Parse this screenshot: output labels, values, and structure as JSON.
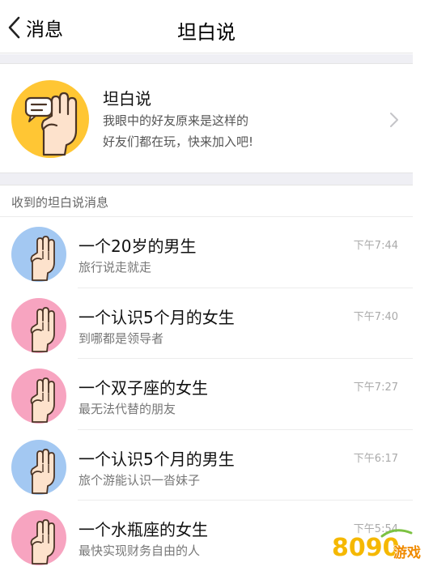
{
  "nav": {
    "back_label": "消息",
    "title": "坦白说"
  },
  "banner": {
    "title": "坦白说",
    "desc_line1": "我眼中的好友原来是这样的",
    "desc_line2": "好友们都在玩，快来加入吧!"
  },
  "section": {
    "header": "收到的坦白说消息"
  },
  "messages": [
    {
      "title": "一个20岁的男生",
      "subtitle": "旅行说走就走",
      "time": "下午7:44",
      "avatar_color": "#a3c8f2"
    },
    {
      "title": "一个认识5个月的女生",
      "subtitle": "到哪都是领导者",
      "time": "下午7:40",
      "avatar_color": "#f7a4c0"
    },
    {
      "title": "一个双子座的女生",
      "subtitle": "最无法代替的朋友",
      "time": "下午7:27",
      "avatar_color": "#f7a4c0"
    },
    {
      "title": "一个认识5个月的男生",
      "subtitle": "旅个游能认识一沓妹子",
      "time": "下午6:17",
      "avatar_color": "#a3c8f2"
    },
    {
      "title": "一个水瓶座的女生",
      "subtitle": "最快实现财务自由的人",
      "time": "下午5:54",
      "avatar_color": "#f7a4c0"
    }
  ],
  "watermark": {
    "text": "8090游戏"
  }
}
